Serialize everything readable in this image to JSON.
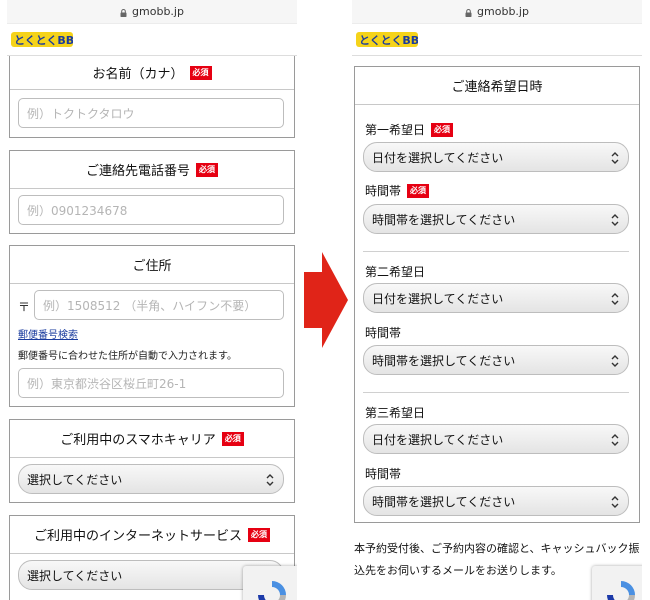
{
  "left": {
    "url": "gmobb.jp",
    "logo": "とくとくBB",
    "name_kana": {
      "heading": "お名前（カナ）",
      "required": "必須",
      "placeholder": "例）トクトクタロウ"
    },
    "phone": {
      "heading": "ご連絡先電話番号",
      "required": "必須",
      "placeholder": "例）0901234678"
    },
    "address": {
      "heading": "ご住所",
      "postal_mark": "〒",
      "postal_placeholder": "例）1508512 （半角、ハイフン不要）",
      "postal_search_link": "郵便番号検索",
      "note": "郵便番号に合わせた住所が自動で入力されます。",
      "address_placeholder": "例）東京都渋谷区桜丘町26-1"
    },
    "carrier": {
      "heading": "ご利用中のスマホキャリア",
      "required": "必須",
      "select_value": "選択してください"
    },
    "internet": {
      "heading": "ご利用中のインターネットサービス",
      "required": "必須",
      "select_value": "選択してください"
    }
  },
  "right": {
    "url": "gmobb.jp",
    "logo": "とくとくBB",
    "panel_heading": "ご連絡希望日時",
    "choices": [
      {
        "date_label": "第一希望日",
        "date_required": "必須",
        "date_value": "日付を選択してください",
        "time_label": "時間帯",
        "time_required": "必須",
        "time_value": "時間帯を選択してください"
      },
      {
        "date_label": "第二希望日",
        "date_value": "日付を選択してください",
        "time_label": "時間帯",
        "time_value": "時間帯を選択してください"
      },
      {
        "date_label": "第三希望日",
        "date_value": "日付を選択してください",
        "time_label": "時間帯",
        "time_value": "時間帯を選択してください"
      }
    ],
    "footer_text": "本予約受付後、ご予約内容の確認と、キャッシュバック振込先をお伺いするメールをお送りします。"
  },
  "colors": {
    "required_badge": "#e60012",
    "arrow": "#e02418",
    "link": "#1a3b9e"
  },
  "icons": {
    "lock": "lock-icon",
    "chevron": "chevron-updown-icon",
    "recaptcha": "recaptcha-icon",
    "arrow": "right-arrow-icon"
  }
}
